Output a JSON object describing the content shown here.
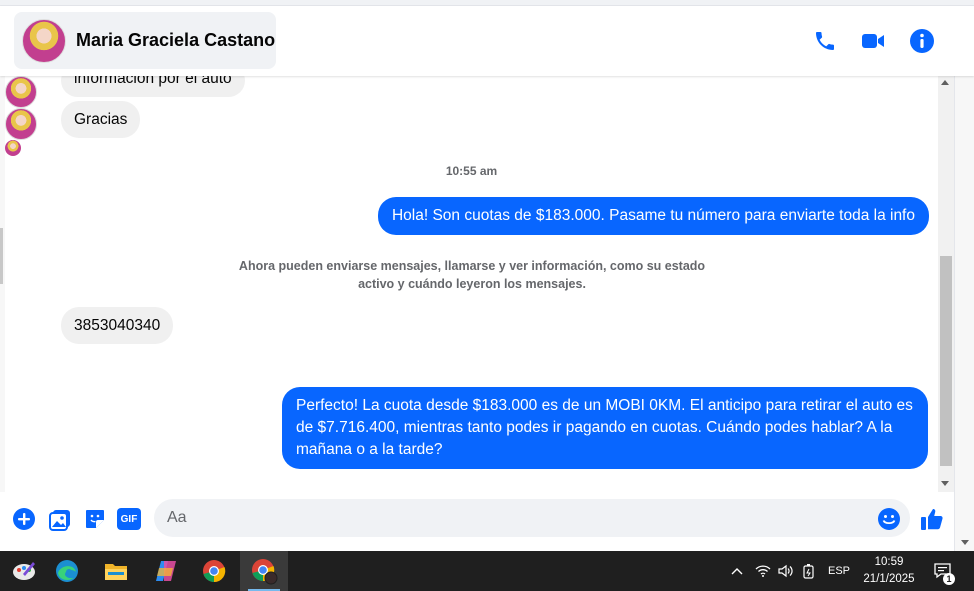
{
  "header": {
    "contact_name": "Maria Graciela Castano",
    "icons": [
      "phone-icon",
      "video-call-icon",
      "info-icon"
    ]
  },
  "conversation": {
    "partial_message": "información por el auto",
    "msg_gracias": "Gracias",
    "timestamp": "10:55 am",
    "msg_out_1": "Hola! Son cuotas de $183.000. Pasame tu número para enviarte toda la info",
    "system_notice": "Ahora pueden enviarse mensajes, llamarse y ver información, como su estado activo y cuándo leyeron los mensajes.",
    "msg_phone": "3853040340",
    "msg_out_2": "Perfecto! La cuota desde $183.000 es de un MOBI 0KM. El anticipo para retirar el auto es de $7.716.400, mientras tanto podes ir pagando en cuotas. Cuándo podes hablar? A la mañana o a la tarde?"
  },
  "composer": {
    "placeholder": "Aa",
    "gif_label": "GIF",
    "icons": [
      "add-icon",
      "gallery-icon",
      "sticker-icon",
      "gif-icon",
      "emoji-icon",
      "like-icon"
    ]
  },
  "taskbar": {
    "apps": [
      "paint-icon",
      "edge-icon",
      "file-explorer-icon",
      "copilot-icon",
      "chrome-icon",
      "chrome-profile-icon"
    ],
    "language": "ESP",
    "time": "10:59",
    "date": "21/1/2025",
    "notification_count": "1"
  },
  "colors": {
    "accent": "#0866ff",
    "incoming_bubble": "#f0f0f0",
    "taskbar": "#1f1f1f"
  }
}
